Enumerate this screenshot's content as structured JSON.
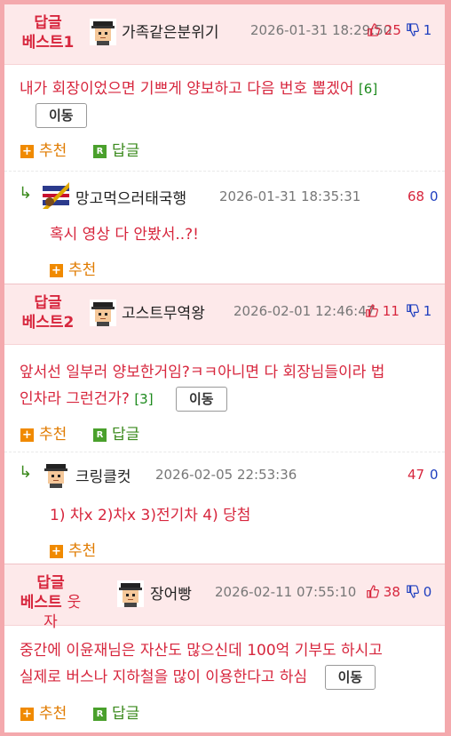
{
  "comments": [
    {
      "badge": "답글",
      "badge_sub": "베스트1",
      "nick": "가족같은분위기",
      "date": "2026-01-31 18:29:50",
      "up": "25",
      "down": "1",
      "text": "내가 회장이었으면 기쁘게 양보하고 다음 번호 뽑겠어",
      "count": "[6]",
      "move": "이동",
      "recommend": "추천",
      "reply": "답글",
      "reply_item": {
        "nick": "망고먹으러태국행",
        "date": "2026-01-31 18:35:31",
        "up": "68",
        "down": "0",
        "text": "혹시 영상 다 안봤서..?!",
        "recommend": "추천"
      }
    },
    {
      "badge": "답글",
      "badge_sub": "베스트2",
      "nick": "고스트무역왕",
      "date": "2026-02-01 12:46:47",
      "up": "11",
      "down": "1",
      "text1": "앞서선 일부러 양보한거임?ㅋㅋ아니면 다 회장님들이라 법",
      "text2": "인차라 그런건가?",
      "count": "[3]",
      "move": "이동",
      "recommend": "추천",
      "reply": "답글",
      "reply_item": {
        "nick": "크링클컷",
        "date": "2026-02-05 22:53:36",
        "up": "47",
        "down": "0",
        "text": "1) 차x 2)차x 3)전기차 4) 당첨",
        "recommend": "추천"
      }
    },
    {
      "badge": "답글",
      "badge_sub1": "베스트",
      "badge_sub2": "웃자",
      "nick": "장어빵",
      "date": "2026-02-11 07:55:10",
      "up": "38",
      "down": "0",
      "text1": "중간에 이윤재님은 자산도 많으신데 100억 기부도 하시고",
      "text2": "실제로 버스나 지하철을 많이 이용한다고 하심",
      "move": "이동",
      "recommend": "추천",
      "reply": "답글"
    }
  ],
  "icons": {
    "up": "thumbs-up-icon",
    "down": "thumbs-down-icon",
    "reply_arrow": "reply-arrow-icon",
    "recommend": "plus-box-icon",
    "reply": "r-box-icon"
  },
  "colors": {
    "accent": "#d7263d",
    "blue": "#1f3fbf",
    "green": "#3b8a1d",
    "orange": "#f08a00",
    "header_bg": "#fde9ea",
    "frame": "#f4a9ad"
  }
}
